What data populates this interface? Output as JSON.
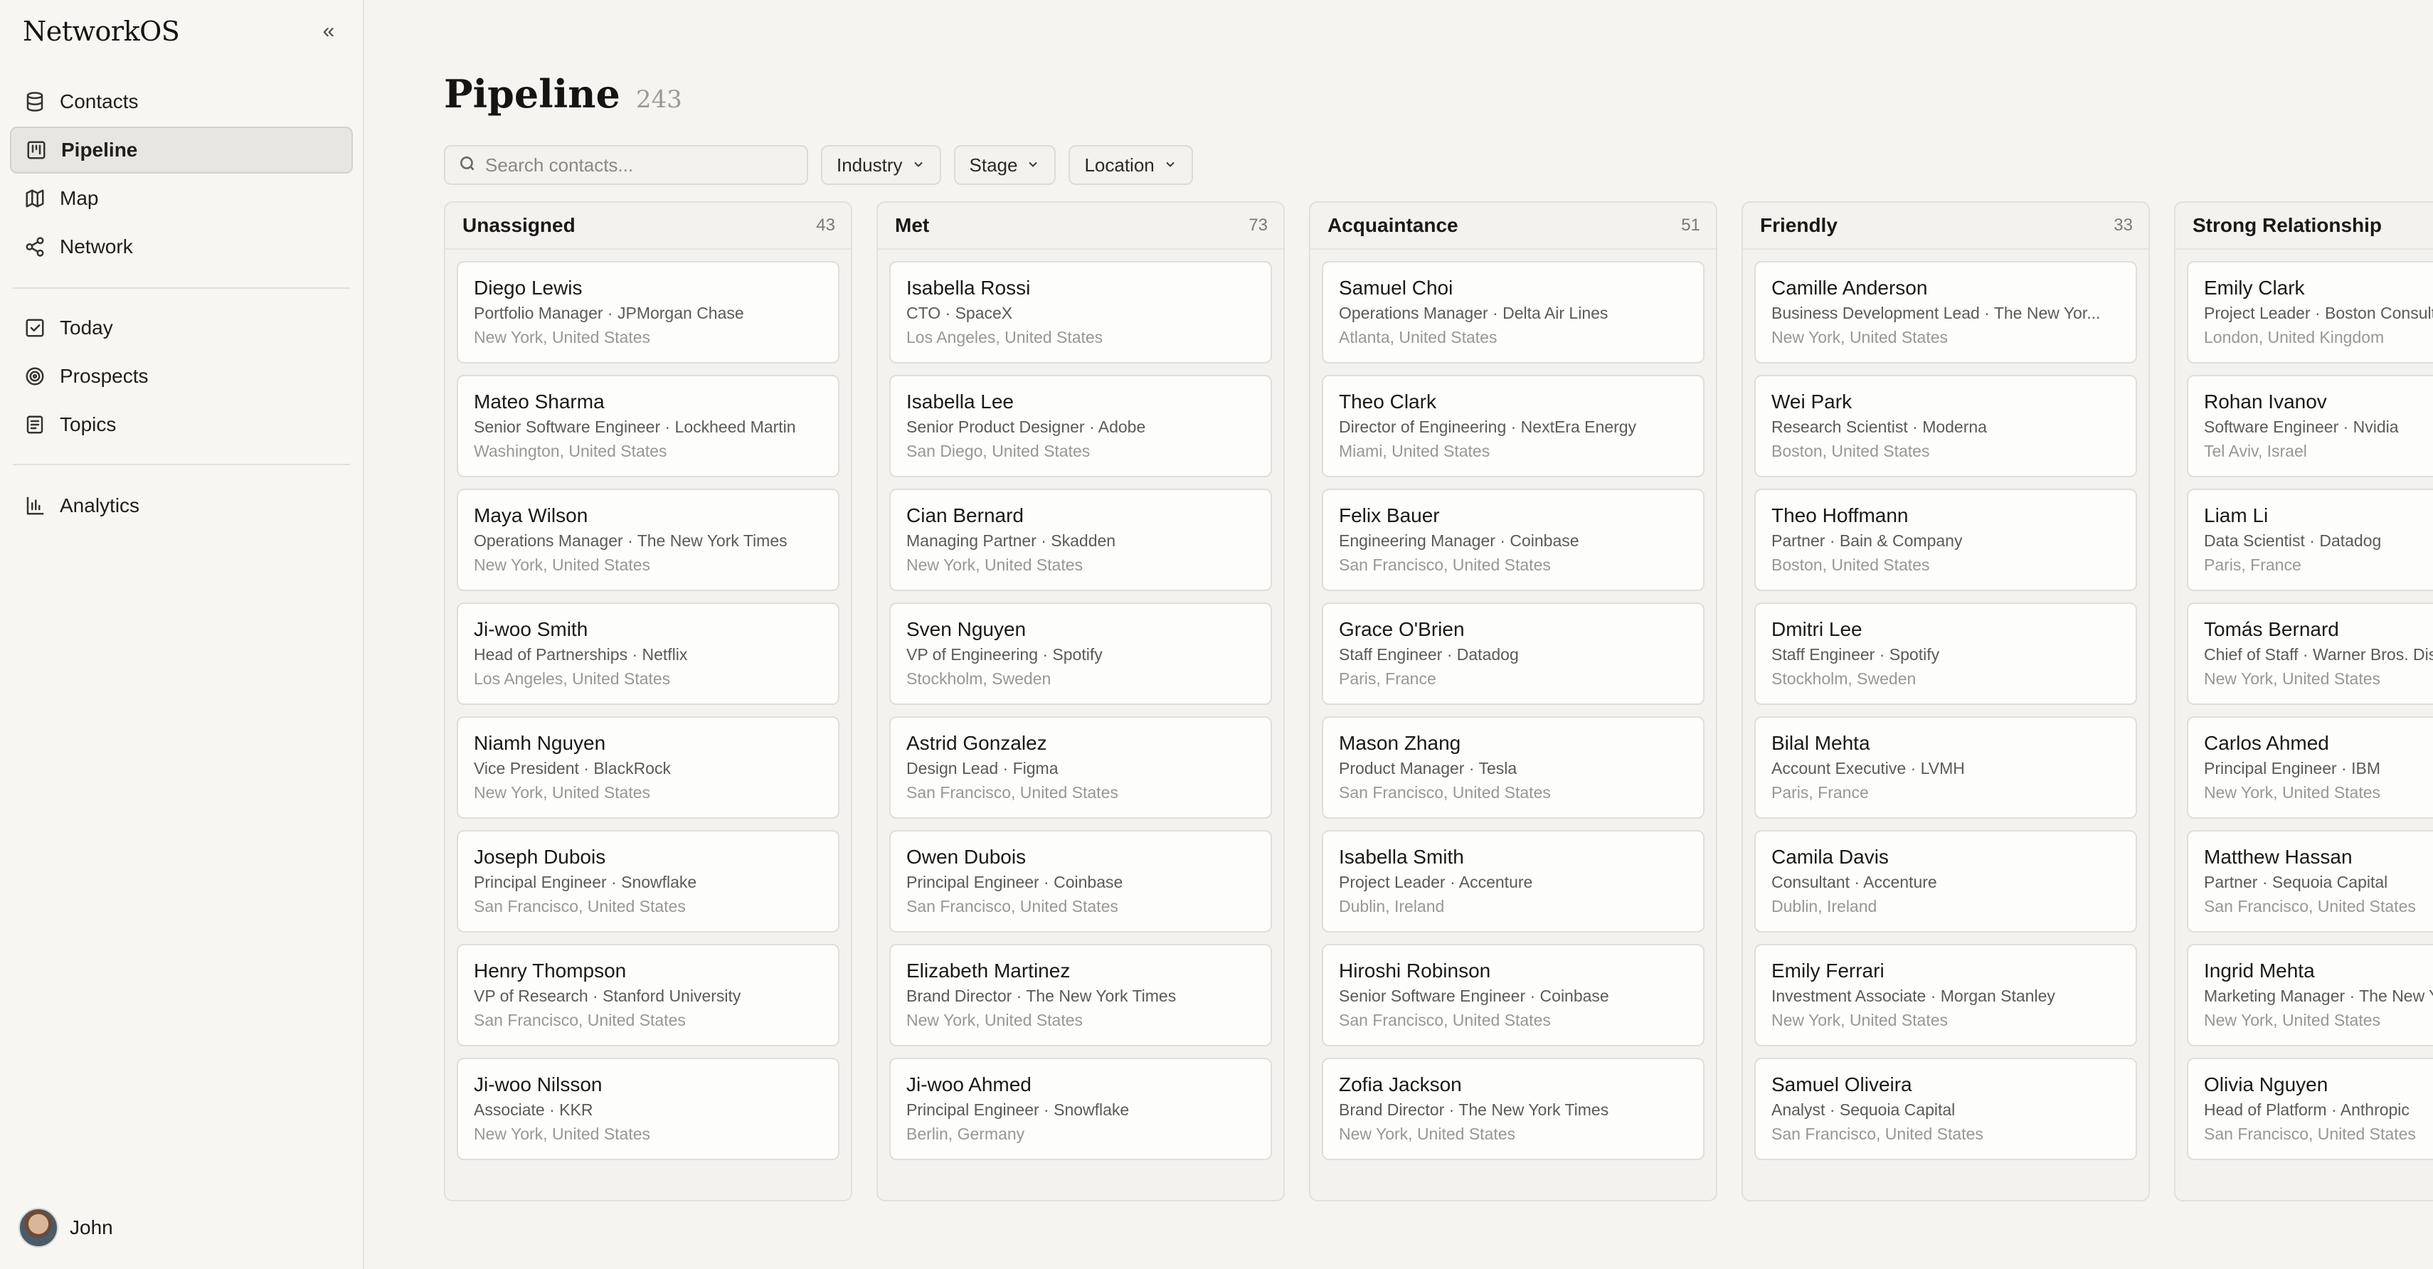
{
  "app": {
    "name": "NetworkOS"
  },
  "sidebar": {
    "items": [
      {
        "label": "Contacts",
        "icon": "database-icon"
      },
      {
        "label": "Pipeline",
        "icon": "kanban-icon",
        "active": true
      },
      {
        "label": "Map",
        "icon": "map-icon"
      },
      {
        "label": "Network",
        "icon": "share-icon"
      },
      {
        "label": "Today",
        "icon": "check-square-icon"
      },
      {
        "label": "Prospects",
        "icon": "target-icon"
      },
      {
        "label": "Topics",
        "icon": "book-icon"
      },
      {
        "label": "Analytics",
        "icon": "bar-chart-icon"
      }
    ],
    "user": {
      "name": "John"
    }
  },
  "page": {
    "title": "Pipeline",
    "count": "243"
  },
  "toolbar": {
    "search_placeholder": "Search contacts...",
    "filters": [
      "Industry",
      "Stage",
      "Location"
    ]
  },
  "columns": [
    {
      "title": "Unassigned",
      "count": "43",
      "cards": [
        {
          "name": "Diego Lewis",
          "role": "Portfolio Manager · JPMorgan Chase",
          "location": "New York, United States"
        },
        {
          "name": "Mateo Sharma",
          "role": "Senior Software Engineer · Lockheed Martin",
          "location": "Washington, United States"
        },
        {
          "name": "Maya Wilson",
          "role": "Operations Manager · The New York Times",
          "location": "New York, United States"
        },
        {
          "name": "Ji-woo Smith",
          "role": "Head of Partnerships · Netflix",
          "location": "Los Angeles, United States"
        },
        {
          "name": "Niamh Nguyen",
          "role": "Vice President · BlackRock",
          "location": "New York, United States"
        },
        {
          "name": "Joseph Dubois",
          "role": "Principal Engineer · Snowflake",
          "location": "San Francisco, United States"
        },
        {
          "name": "Henry Thompson",
          "role": "VP of Research · Stanford University",
          "location": "San Francisco, United States"
        },
        {
          "name": "Ji-woo Nilsson",
          "role": "Associate · KKR",
          "location": "New York, United States"
        }
      ]
    },
    {
      "title": "Met",
      "count": "73",
      "cards": [
        {
          "name": "Isabella Rossi",
          "role": "CTO · SpaceX",
          "location": "Los Angeles, United States"
        },
        {
          "name": "Isabella Lee",
          "role": "Senior Product Designer · Adobe",
          "location": "San Diego, United States"
        },
        {
          "name": "Cian Bernard",
          "role": "Managing Partner · Skadden",
          "location": "New York, United States"
        },
        {
          "name": "Sven Nguyen",
          "role": "VP of Engineering · Spotify",
          "location": "Stockholm, Sweden"
        },
        {
          "name": "Astrid Gonzalez",
          "role": "Design Lead · Figma",
          "location": "San Francisco, United States"
        },
        {
          "name": "Owen Dubois",
          "role": "Principal Engineer · Coinbase",
          "location": "San Francisco, United States"
        },
        {
          "name": "Elizabeth Martinez",
          "role": "Brand Director · The New York Times",
          "location": "New York, United States"
        },
        {
          "name": "Ji-woo Ahmed",
          "role": "Principal Engineer · Snowflake",
          "location": "Berlin, Germany"
        }
      ]
    },
    {
      "title": "Acquaintance",
      "count": "51",
      "cards": [
        {
          "name": "Samuel Choi",
          "role": "Operations Manager · Delta Air Lines",
          "location": "Atlanta, United States"
        },
        {
          "name": "Theo Clark",
          "role": "Director of Engineering · NextEra Energy",
          "location": "Miami, United States"
        },
        {
          "name": "Felix Bauer",
          "role": "Engineering Manager · Coinbase",
          "location": "San Francisco, United States"
        },
        {
          "name": "Grace O'Brien",
          "role": "Staff Engineer · Datadog",
          "location": "Paris, France"
        },
        {
          "name": "Mason Zhang",
          "role": "Product Manager · Tesla",
          "location": "San Francisco, United States"
        },
        {
          "name": "Isabella Smith",
          "role": "Project Leader · Accenture",
          "location": "Dublin, Ireland"
        },
        {
          "name": "Hiroshi Robinson",
          "role": "Senior Software Engineer · Coinbase",
          "location": "San Francisco, United States"
        },
        {
          "name": "Zofia Jackson",
          "role": "Brand Director · The New York Times",
          "location": "New York, United States"
        }
      ]
    },
    {
      "title": "Friendly",
      "count": "33",
      "cards": [
        {
          "name": "Camille Anderson",
          "role": "Business Development Lead · The New Yor...",
          "location": "New York, United States"
        },
        {
          "name": "Wei Park",
          "role": "Research Scientist · Moderna",
          "location": "Boston, United States"
        },
        {
          "name": "Theo Hoffmann",
          "role": "Partner · Bain & Company",
          "location": "Boston, United States"
        },
        {
          "name": "Dmitri Lee",
          "role": "Staff Engineer · Spotify",
          "location": "Stockholm, Sweden"
        },
        {
          "name": "Bilal Mehta",
          "role": "Account Executive · LVMH",
          "location": "Paris, France"
        },
        {
          "name": "Camila Davis",
          "role": "Consultant · Accenture",
          "location": "Dublin, Ireland"
        },
        {
          "name": "Emily Ferrari",
          "role": "Investment Associate · Morgan Stanley",
          "location": "New York, United States"
        },
        {
          "name": "Samuel Oliveira",
          "role": "Analyst · Sequoia Capital",
          "location": "San Francisco, United States"
        }
      ]
    },
    {
      "title": "Strong Relationship",
      "count": "",
      "cards": [
        {
          "name": "Emily Clark",
          "role": "Project Leader · Boston Consulting Group",
          "location": "London, United Kingdom"
        },
        {
          "name": "Rohan Ivanov",
          "role": "Software Engineer · Nvidia",
          "location": "Tel Aviv, Israel"
        },
        {
          "name": "Liam Li",
          "role": "Data Scientist · Datadog",
          "location": "Paris, France"
        },
        {
          "name": "Tomás Bernard",
          "role": "Chief of Staff · Warner Bros. Discovery",
          "location": "New York, United States"
        },
        {
          "name": "Carlos Ahmed",
          "role": "Principal Engineer · IBM",
          "location": "New York, United States"
        },
        {
          "name": "Matthew Hassan",
          "role": "Partner · Sequoia Capital",
          "location": "San Francisco, United States"
        },
        {
          "name": "Ingrid Mehta",
          "role": "Marketing Manager · The New York Times",
          "location": "New York, United States"
        },
        {
          "name": "Olivia Nguyen",
          "role": "Head of Platform · Anthropic",
          "location": "San Francisco, United States"
        }
      ]
    }
  ]
}
